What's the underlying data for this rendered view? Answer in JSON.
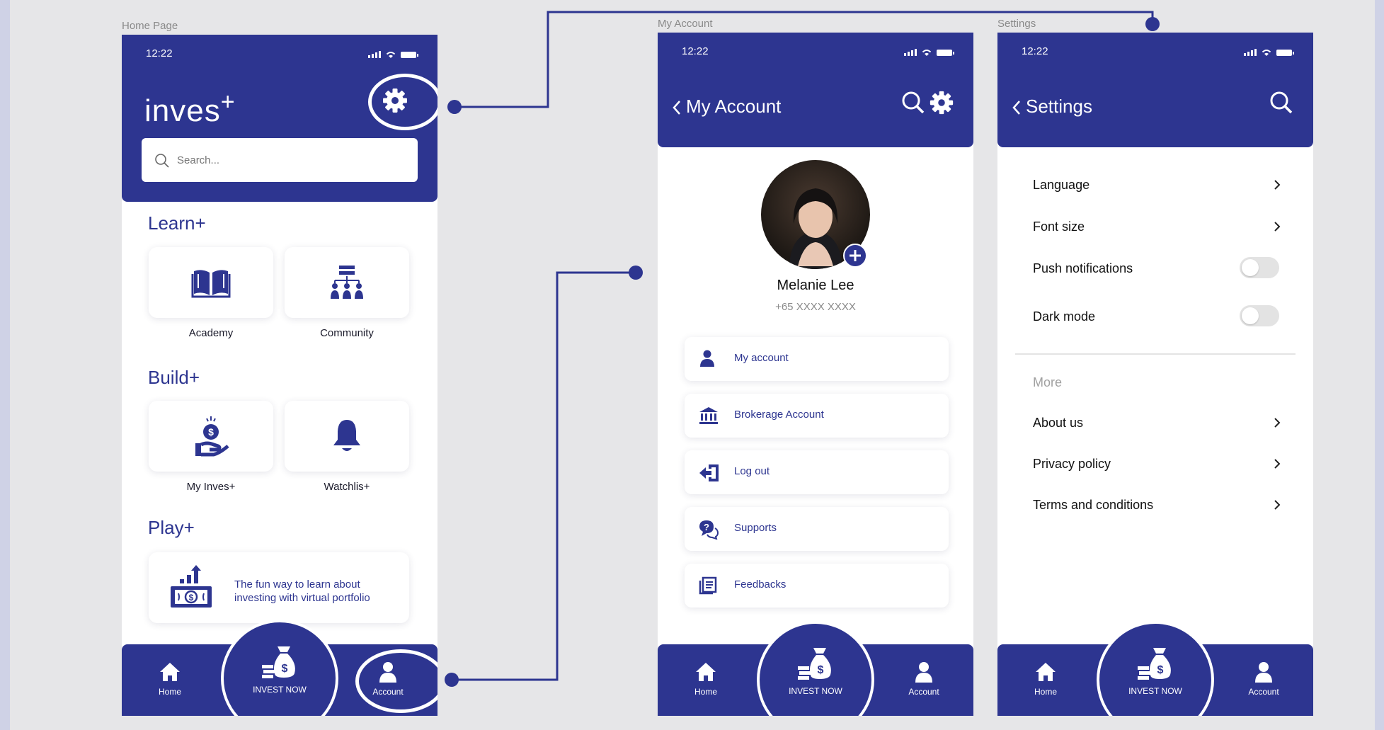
{
  "screens": {
    "home": {
      "frame_label": "Home Page",
      "time": "12:22",
      "brand": "inves",
      "brand_sup": "+",
      "search_placeholder": "Search...",
      "learn": {
        "title": "Learn+",
        "items": [
          {
            "label": "Academy",
            "icon": "book-icon"
          },
          {
            "label": "Community",
            "icon": "community-icon"
          }
        ]
      },
      "build": {
        "title": "Build+",
        "items": [
          {
            "label": "My Inves+",
            "icon": "money-hand-icon"
          },
          {
            "label": "Watchlis+",
            "icon": "bell-icon"
          }
        ]
      },
      "play": {
        "title": "Play+",
        "card_text": "The fun way to learn about investing with virtual portfolio",
        "icon": "money-growth-icon"
      }
    },
    "account": {
      "frame_label": "My Account",
      "time": "12:22",
      "title": "My Account",
      "name": "Melanie Lee",
      "phone": "+65 XXXX XXXX",
      "menu": [
        {
          "label": "My account",
          "icon": "user-icon"
        },
        {
          "label": "Brokerage Account",
          "icon": "bank-icon"
        },
        {
          "label": "Log out",
          "icon": "logout-icon"
        },
        {
          "label": "Supports",
          "icon": "support-icon"
        },
        {
          "label": "Feedbacks",
          "icon": "feedback-icon"
        }
      ]
    },
    "settings": {
      "frame_label": "Settings",
      "time": "12:22",
      "title": "Settings",
      "rows": [
        {
          "label": "Language",
          "control": "chevron"
        },
        {
          "label": "Font size",
          "control": "chevron"
        },
        {
          "label": "Push notifications",
          "control": "toggle",
          "on": false
        },
        {
          "label": "Dark mode",
          "control": "toggle",
          "on": false
        }
      ],
      "more_label": "More",
      "more_rows": [
        {
          "label": "About us"
        },
        {
          "label": "Privacy policy"
        },
        {
          "label": "Terms and conditions"
        }
      ]
    }
  },
  "tabbar": {
    "home": "Home",
    "invest": "INVEST NOW",
    "account": "Account"
  },
  "colors": {
    "primary": "#2d3590",
    "canvas": "#e6e6e8",
    "backdrop": "#cfd2e6",
    "toggle_off": "#e3e3e3"
  }
}
